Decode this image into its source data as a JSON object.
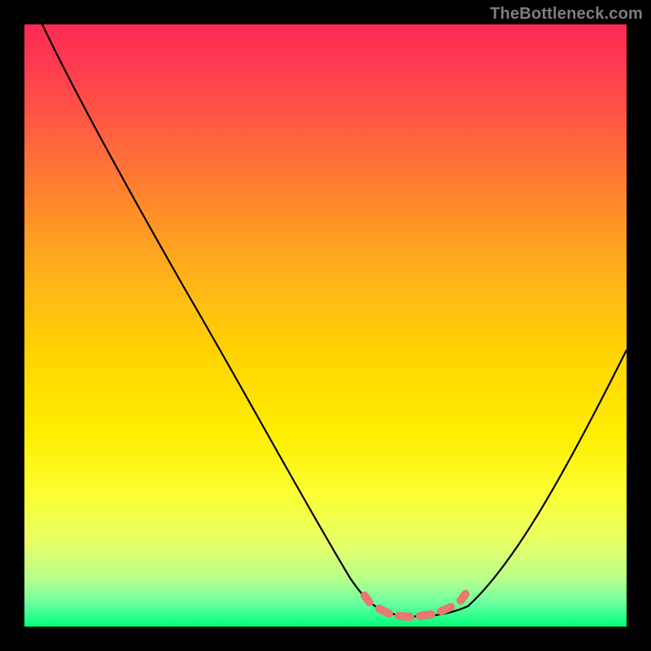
{
  "watermark": "TheBottleneck.com",
  "colors": {
    "page_bg": "#000000",
    "gradient_top": "#ff2a55",
    "gradient_bottom": "#00ff7b",
    "curve": "#000000",
    "valley_marker": "#e8796e",
    "watermark": "#7e7e7e"
  },
  "chart_data": {
    "type": "line",
    "title": "",
    "xlabel": "",
    "ylabel": "",
    "xlim": [
      0,
      100
    ],
    "ylim": [
      0,
      100
    ],
    "grid": false,
    "legend": false,
    "series": [
      {
        "name": "bottleneck-curve",
        "x": [
          3,
          10,
          20,
          30,
          40,
          50,
          55,
          58,
          62,
          66,
          70,
          75,
          80,
          85,
          90,
          95,
          100
        ],
        "y": [
          100,
          88,
          72,
          56,
          40,
          24,
          14,
          7,
          2,
          0,
          0,
          2,
          7,
          14,
          24,
          36,
          50
        ]
      }
    ],
    "annotations": [
      {
        "name": "optimal-range-marker",
        "x_start": 58,
        "x_end": 74,
        "y": 3
      }
    ]
  }
}
